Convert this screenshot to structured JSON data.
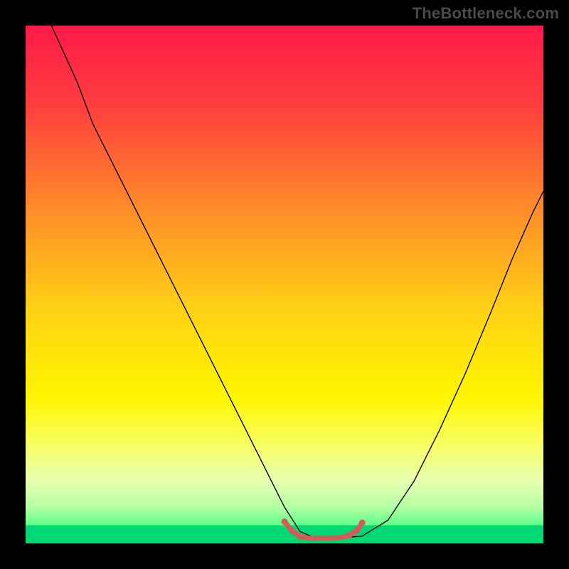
{
  "watermark": "TheBottleneck.com",
  "chart_data": {
    "type": "line",
    "title": "",
    "xlabel": "",
    "ylabel": "",
    "xlim": [
      0,
      100
    ],
    "ylim": [
      0,
      100
    ],
    "grid": false,
    "legend": false,
    "background_gradient": {
      "stops": [
        {
          "offset": 0.0,
          "color": "#ff1a49"
        },
        {
          "offset": 0.15,
          "color": "#ff3c3f"
        },
        {
          "offset": 0.35,
          "color": "#ff8a2a"
        },
        {
          "offset": 0.55,
          "color": "#ffd214"
        },
        {
          "offset": 0.72,
          "color": "#fff600"
        },
        {
          "offset": 0.82,
          "color": "#f6ff6e"
        },
        {
          "offset": 0.88,
          "color": "#e7ffb0"
        },
        {
          "offset": 0.93,
          "color": "#b4ffa4"
        },
        {
          "offset": 0.965,
          "color": "#5dff89"
        },
        {
          "offset": 1.0,
          "color": "#00e276"
        }
      ]
    },
    "baseline_band": {
      "y_from": 96.5,
      "y_to": 100,
      "color": "#00d873"
    },
    "series": [
      {
        "name": "main-curve",
        "color": "#000000",
        "width": 1.4,
        "x": [
          5,
          10,
          13,
          17,
          22,
          28,
          34,
          40,
          46,
          50,
          53,
          56,
          60,
          65,
          70,
          75,
          80,
          85,
          90,
          94,
          98,
          100
        ],
        "y": [
          100,
          89,
          81,
          73,
          63,
          51,
          39,
          27,
          15,
          7,
          2.3,
          1.0,
          1.0,
          1.4,
          4.5,
          12,
          22,
          33,
          45,
          55,
          64,
          68
        ]
      },
      {
        "name": "valley-highlight",
        "color": "#d65a57",
        "width": 7,
        "linecap": "round",
        "x": [
          50,
          51.5,
          53,
          55,
          57,
          59,
          61,
          62.5,
          64,
          65
        ],
        "y": [
          4.2,
          2.4,
          1.3,
          1.0,
          1.0,
          1.0,
          1.15,
          1.55,
          2.5,
          4.0
        ]
      }
    ],
    "valley_dots": {
      "color": "#d65a57",
      "r": 4.5,
      "points": [
        {
          "x": 50,
          "y": 4.2
        },
        {
          "x": 51.5,
          "y": 2.4
        },
        {
          "x": 53,
          "y": 1.3
        },
        {
          "x": 62.5,
          "y": 1.55
        },
        {
          "x": 64,
          "y": 2.5
        },
        {
          "x": 65,
          "y": 4.0
        }
      ]
    }
  }
}
